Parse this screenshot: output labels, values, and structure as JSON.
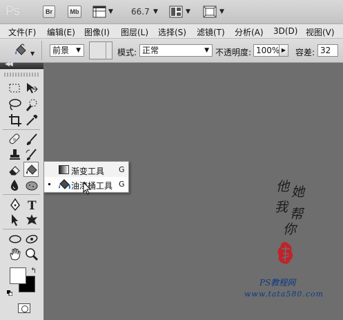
{
  "app": {
    "logo": "Ps"
  },
  "app_bar": {
    "bridge_label": "Br",
    "minibridge_label": "Mb",
    "zoom": "66.7"
  },
  "menu": [
    "文件(F)",
    "编辑(E)",
    "图像(I)",
    "图层(L)",
    "选择(S)",
    "滤镜(T)",
    "分析(A)",
    "3D(D)",
    "视图(V)"
  ],
  "options": {
    "fill_source": "前景",
    "mode_label": "模式:",
    "mode_value": "正常",
    "opacity_label": "不透明度:",
    "opacity_value": "100%",
    "tolerance_label": "容差:",
    "tolerance_value": "32"
  },
  "flyout": {
    "items": [
      {
        "label": "渐变工具",
        "shortcut": "G",
        "icon": "gradient-icon",
        "selected": false
      },
      {
        "label": "油漆桶工具",
        "shortcut": "G",
        "icon": "paint-bucket-icon",
        "selected": true
      }
    ]
  },
  "watermark": {
    "chars": [
      "他",
      "她",
      "我",
      "帮",
      "你"
    ],
    "site_title": "PS教程网",
    "site_url": "www.tata580.com"
  },
  "colors": {
    "canvas": "#6e6e6e",
    "foreground": "#ffffff",
    "background": "#000000",
    "watermark_blue": "#0c3a86",
    "stamp_red": "#c0242b"
  }
}
